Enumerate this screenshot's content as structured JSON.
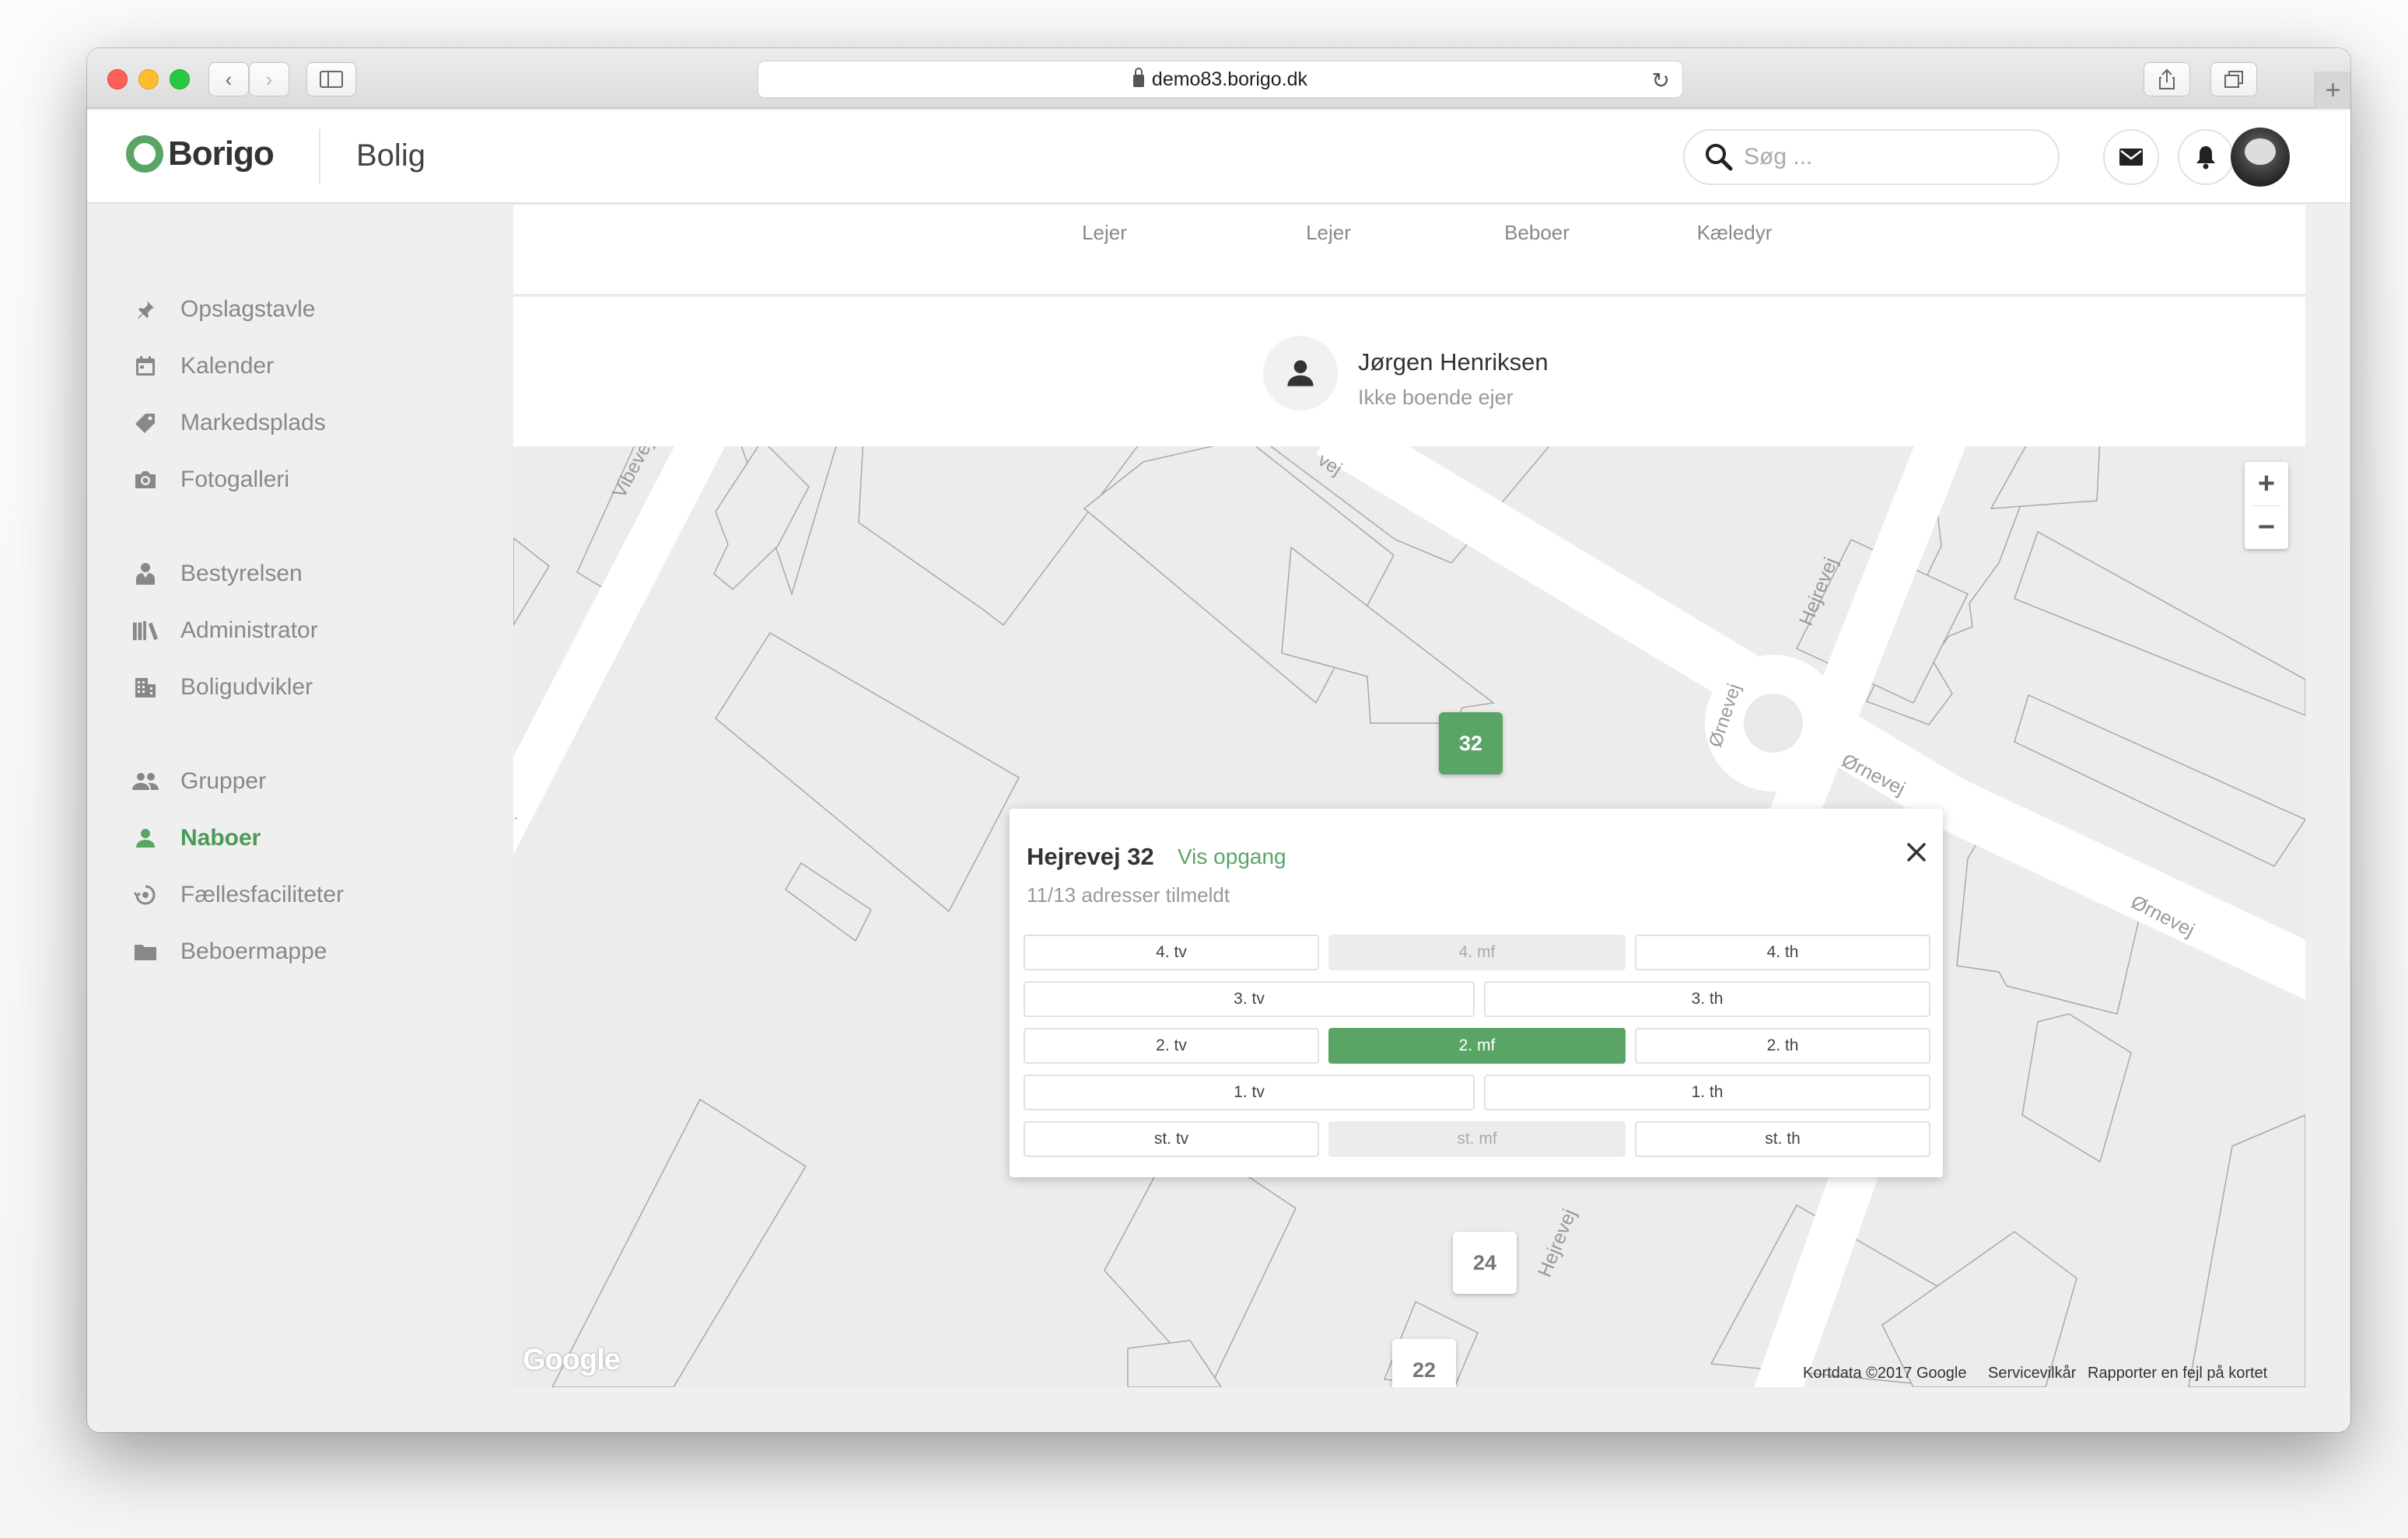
{
  "browser": {
    "url": "demo83.borigo.dk"
  },
  "header": {
    "brand": "Borigo",
    "section": "Bolig",
    "search_placeholder": "Søg ..."
  },
  "sidebar": {
    "groups": [
      [
        {
          "label": "Opslagstavle",
          "icon": "pin-icon"
        },
        {
          "label": "Kalender",
          "icon": "calendar-icon"
        },
        {
          "label": "Markedsplads",
          "icon": "tag-icon"
        },
        {
          "label": "Fotogalleri",
          "icon": "camera-icon"
        }
      ],
      [
        {
          "label": "Bestyrelsen",
          "icon": "board-member-icon"
        },
        {
          "label": "Administrator",
          "icon": "library-icon"
        },
        {
          "label": "Boligudvikler",
          "icon": "building-icon"
        }
      ],
      [
        {
          "label": "Grupper",
          "icon": "group-icon"
        },
        {
          "label": "Naboer",
          "icon": "person-icon",
          "active": true
        },
        {
          "label": "Fællesfaciliteter",
          "icon": "facilities-icon"
        },
        {
          "label": "Beboermappe",
          "icon": "folder-icon"
        }
      ]
    ]
  },
  "residents": {
    "roles": [
      "Lejer",
      "Lejer",
      "Beboer",
      "Kæledyr"
    ],
    "owner_name": "Jørgen Henriksen",
    "owner_type": "Ikke boende ejer"
  },
  "map": {
    "streets": [
      "Vibevej",
      "Hejrevej",
      "Ørnevej",
      "Ørnevej",
      "Ørnevej",
      "Hejrevej",
      "ej",
      "vej"
    ],
    "markers": [
      "32",
      "24",
      "22"
    ],
    "zoom_in": "+",
    "zoom_out": "−",
    "provider": "Google",
    "attribution": "Kortdata ©2017 Google",
    "terms": "Servicevilkår",
    "report": "Rapporter en fejl på kortet"
  },
  "popup": {
    "title": "Hejrevej 32",
    "link": "Vis opgang",
    "subtitle": "11/13 adresser tilmeldt",
    "floors": [
      [
        {
          "label": "4. tv"
        },
        {
          "label": "4. mf",
          "disabled": true
        },
        {
          "label": "4. th"
        }
      ],
      [
        {
          "label": "3. tv"
        },
        {
          "label": "3. th"
        }
      ],
      [
        {
          "label": "2. tv"
        },
        {
          "label": "2. mf",
          "selected": true
        },
        {
          "label": "2. th"
        }
      ],
      [
        {
          "label": "1. tv"
        },
        {
          "label": "1. th"
        }
      ],
      [
        {
          "label": "st. tv"
        },
        {
          "label": "st. mf",
          "disabled": true
        },
        {
          "label": "st. th"
        }
      ]
    ]
  },
  "colors": {
    "accent": "#5aa566"
  }
}
